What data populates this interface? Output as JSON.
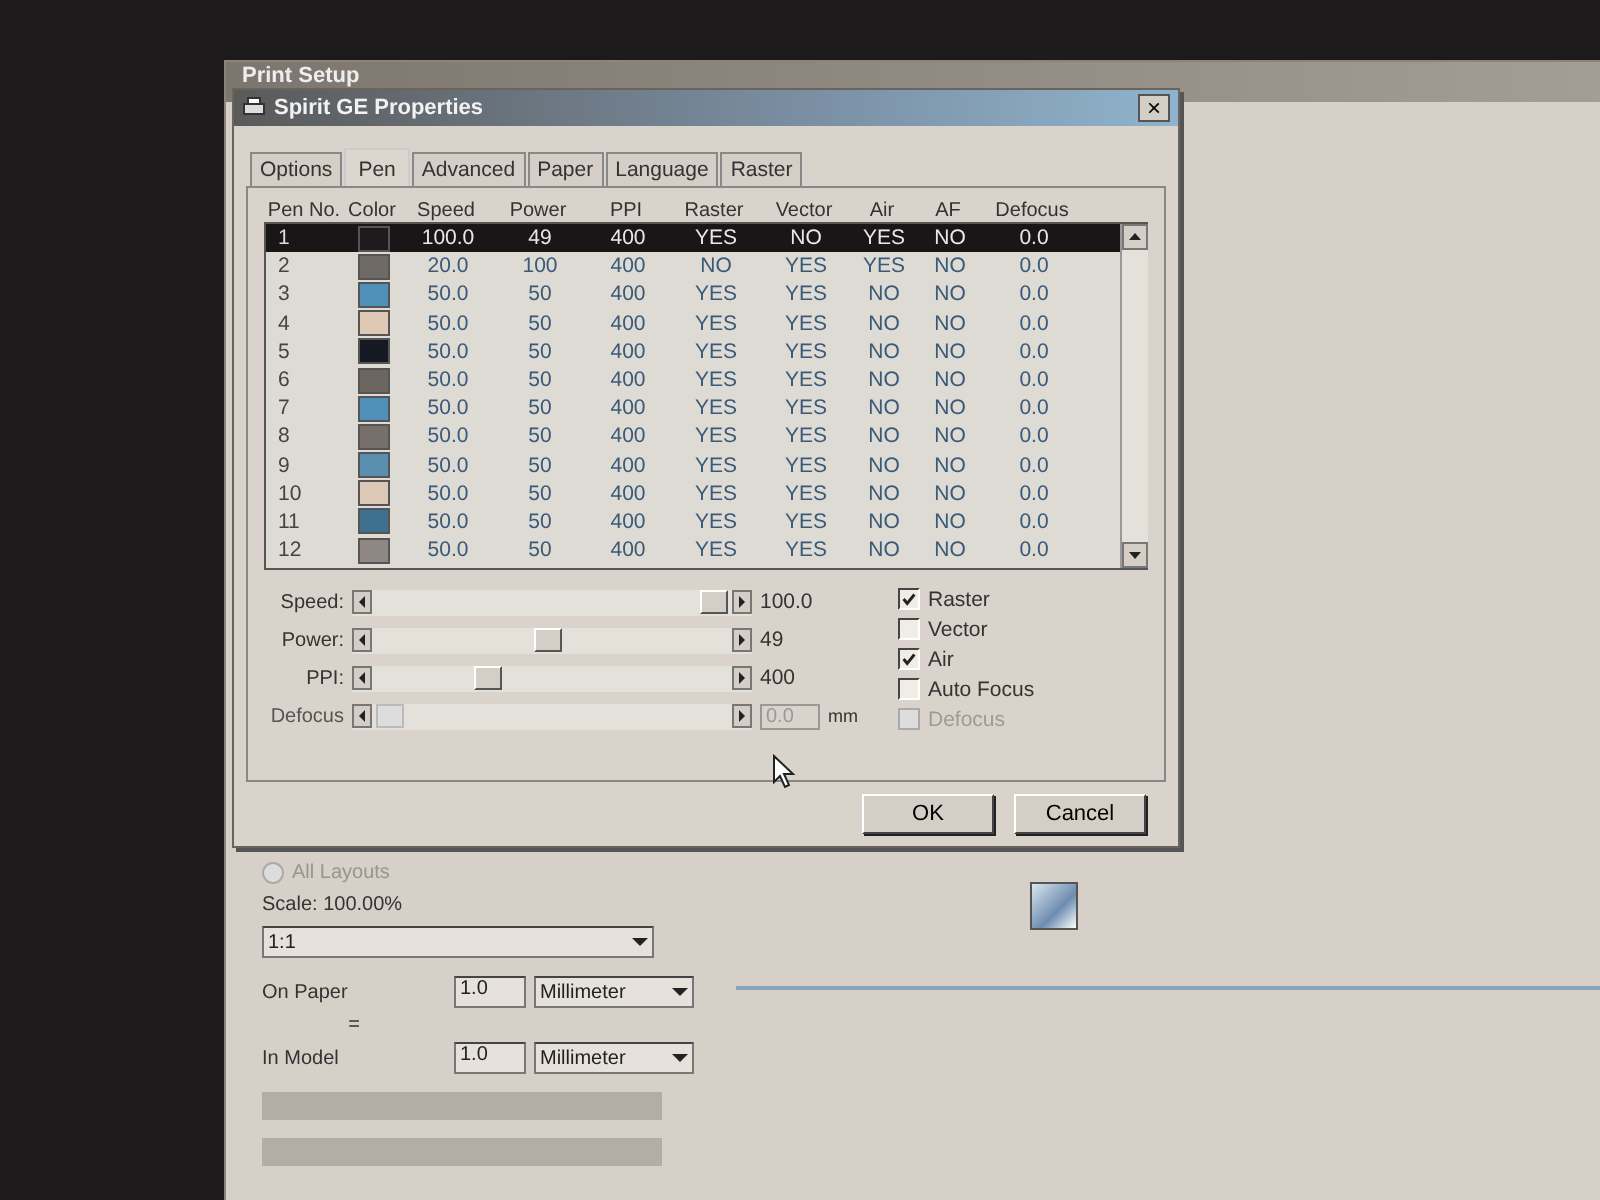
{
  "background_window": {
    "title": "Print Setup",
    "all_layouts": {
      "label": "All Layouts",
      "selected": false,
      "disabled": true
    },
    "scale_label": "Scale: 100.00%",
    "scale_combo": "1:1",
    "on_paper": {
      "label": "On Paper",
      "value": "1.0",
      "unit": "Millimeter"
    },
    "equals": "=",
    "in_model": {
      "label": "In Model",
      "value": "1.0",
      "unit": "Millimeter"
    }
  },
  "dialog": {
    "title": "Spirit GE Properties",
    "close": "×",
    "tabs": [
      {
        "label": "Options",
        "selected": false
      },
      {
        "label": "Pen",
        "selected": true
      },
      {
        "label": "Advanced",
        "selected": false
      },
      {
        "label": "Paper",
        "selected": false
      },
      {
        "label": "Language",
        "selected": false
      },
      {
        "label": "Raster",
        "selected": false
      }
    ],
    "table": {
      "columns": [
        "Pen No.",
        "Color",
        "Speed",
        "Power",
        "PPI",
        "Raster",
        "Vector",
        "Air",
        "AF",
        "Defocus"
      ],
      "rows": [
        {
          "pen": "1",
          "color": "#1c1a1c",
          "speed": "100.0",
          "power": "49",
          "ppi": "400",
          "raster": "YES",
          "vector": "NO",
          "air": "YES",
          "af": "NO",
          "defocus": "0.0",
          "selected": true
        },
        {
          "pen": "2",
          "color": "#6f6a66",
          "speed": "20.0",
          "power": "100",
          "ppi": "400",
          "raster": "NO",
          "vector": "YES",
          "air": "YES",
          "af": "NO",
          "defocus": "0.0",
          "selected": false
        },
        {
          "pen": "3",
          "color": "#4f8fb8",
          "speed": "50.0",
          "power": "50",
          "ppi": "400",
          "raster": "YES",
          "vector": "YES",
          "air": "NO",
          "af": "NO",
          "defocus": "0.0",
          "selected": false
        },
        {
          "pen": "4",
          "color": "#e0c9b4",
          "speed": "50.0",
          "power": "50",
          "ppi": "400",
          "raster": "YES",
          "vector": "YES",
          "air": "NO",
          "af": "NO",
          "defocus": "0.0",
          "selected": false
        },
        {
          "pen": "5",
          "color": "#151a22",
          "speed": "50.0",
          "power": "50",
          "ppi": "400",
          "raster": "YES",
          "vector": "YES",
          "air": "NO",
          "af": "NO",
          "defocus": "0.0",
          "selected": false
        },
        {
          "pen": "6",
          "color": "#6d6660",
          "speed": "50.0",
          "power": "50",
          "ppi": "400",
          "raster": "YES",
          "vector": "YES",
          "air": "NO",
          "af": "NO",
          "defocus": "0.0",
          "selected": false
        },
        {
          "pen": "7",
          "color": "#4f8fb8",
          "speed": "50.0",
          "power": "50",
          "ppi": "400",
          "raster": "YES",
          "vector": "YES",
          "air": "NO",
          "af": "NO",
          "defocus": "0.0",
          "selected": false
        },
        {
          "pen": "8",
          "color": "#77706a",
          "speed": "50.0",
          "power": "50",
          "ppi": "400",
          "raster": "YES",
          "vector": "YES",
          "air": "NO",
          "af": "NO",
          "defocus": "0.0",
          "selected": false
        },
        {
          "pen": "9",
          "color": "#5b8fb0",
          "speed": "50.0",
          "power": "50",
          "ppi": "400",
          "raster": "YES",
          "vector": "YES",
          "air": "NO",
          "af": "NO",
          "defocus": "0.0",
          "selected": false
        },
        {
          "pen": "10",
          "color": "#ddc8b6",
          "speed": "50.0",
          "power": "50",
          "ppi": "400",
          "raster": "YES",
          "vector": "YES",
          "air": "NO",
          "af": "NO",
          "defocus": "0.0",
          "selected": false
        },
        {
          "pen": "11",
          "color": "#3f7090",
          "speed": "50.0",
          "power": "50",
          "ppi": "400",
          "raster": "YES",
          "vector": "YES",
          "air": "NO",
          "af": "NO",
          "defocus": "0.0",
          "selected": false
        },
        {
          "pen": "12",
          "color": "#8f8882",
          "speed": "50.0",
          "power": "50",
          "ppi": "400",
          "raster": "YES",
          "vector": "YES",
          "air": "NO",
          "af": "NO",
          "defocus": "0.0",
          "selected": false
        }
      ]
    },
    "sliders": [
      {
        "label": "Speed:",
        "level": 1.0,
        "reading": "100.0",
        "disabled": false
      },
      {
        "label": "Power:",
        "level": 0.49,
        "reading": "49",
        "disabled": false
      },
      {
        "label": "PPI:",
        "level": 0.3,
        "reading": "400",
        "disabled": false
      },
      {
        "label": "Defocus",
        "level": 0.0,
        "reading": "0.0",
        "unit": "mm",
        "disabled": true
      }
    ],
    "checkboxes": [
      {
        "label": "Raster",
        "checked": true,
        "disabled": false
      },
      {
        "label": "Vector",
        "checked": false,
        "disabled": false
      },
      {
        "label": "Air",
        "checked": true,
        "disabled": false
      },
      {
        "label": "Auto Focus",
        "checked": false,
        "disabled": false
      },
      {
        "label": "Defocus",
        "checked": false,
        "disabled": true
      }
    ],
    "buttons": [
      "OK",
      "Cancel"
    ]
  }
}
